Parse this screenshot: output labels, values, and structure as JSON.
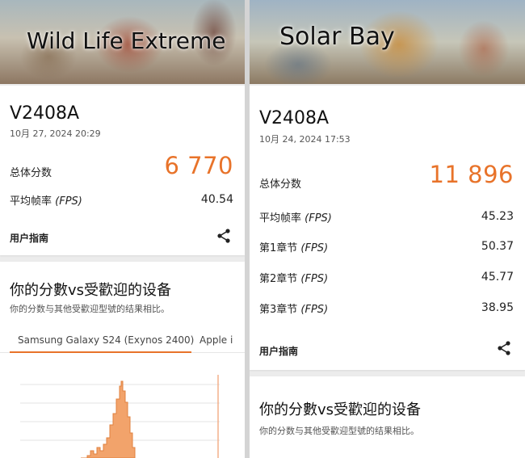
{
  "left": {
    "banner_title": "Wild Life Extreme",
    "result": {
      "device": "V2408A",
      "date": "10月 27, 2024 20:29",
      "total_label": "总体分数",
      "total_score": "6 770",
      "avg_label": "平均帧率",
      "fps_unit": "(FPS)",
      "avg_value": "40.54",
      "guide": "用户指南"
    },
    "popular": {
      "title": "你的分數vs受歡迎的设备",
      "subtitle": "你的分数与其他受歡迎型號的结果相比。",
      "tabs": [
        {
          "label": "Samsung Galaxy S24 (Exynos 2400)",
          "active": true
        },
        {
          "label": "Apple i",
          "active": false
        }
      ]
    }
  },
  "right": {
    "banner_title": "Solar Bay",
    "result": {
      "device": "V2408A",
      "date": "10月 24, 2024 17:53",
      "total_label": "总体分数",
      "total_score": "11 896",
      "rows": [
        {
          "label": "平均帧率",
          "unit": "(FPS)",
          "value": "45.23"
        },
        {
          "label": "第1章节",
          "unit": "(FPS)",
          "value": "50.37"
        },
        {
          "label": "第2章节",
          "unit": "(FPS)",
          "value": "45.77"
        },
        {
          "label": "第3章节",
          "unit": "(FPS)",
          "value": "38.95"
        }
      ],
      "guide": "用户指南"
    },
    "popular": {
      "title": "你的分數vs受歡迎的设备",
      "subtitle": "你的分数与其他受歡迎型號的结果相比。"
    }
  },
  "colors": {
    "accent": "#e8732a",
    "histogram_fill": "#f2a36b",
    "histogram_stroke": "#e0813f"
  },
  "icons": {
    "share": "share-icon"
  }
}
